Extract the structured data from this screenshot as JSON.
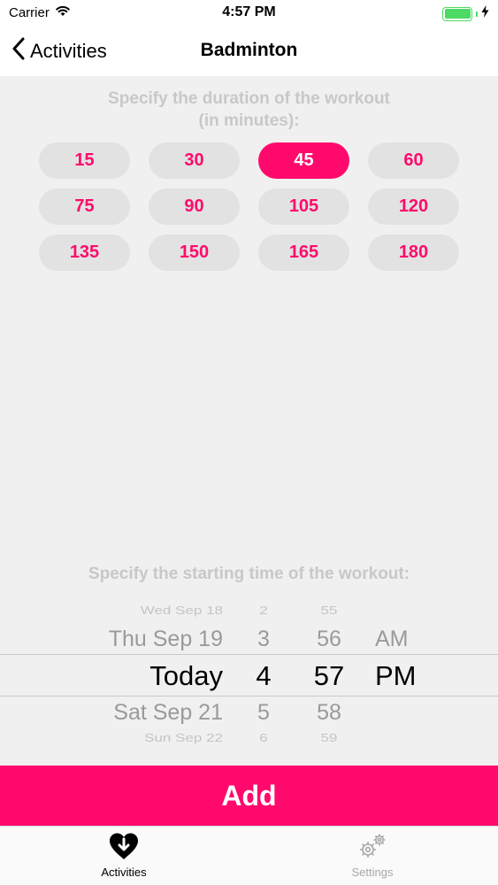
{
  "status_bar": {
    "carrier": "Carrier",
    "time": "4:57 PM",
    "battery_color": "#4cd964",
    "icons": [
      "wifi-icon",
      "battery-icon",
      "charging-bolt-icon"
    ]
  },
  "nav": {
    "back_label": "Activities",
    "title": "Badminton"
  },
  "duration": {
    "title_line1": "Specify the duration of the workout",
    "title_line2": "(in minutes):",
    "options": [
      "15",
      "30",
      "45",
      "60",
      "75",
      "90",
      "105",
      "120",
      "135",
      "150",
      "165",
      "180"
    ],
    "selected": "45"
  },
  "start_time": {
    "title": "Specify the starting time of the workout:",
    "date_column": [
      "Wed Sep 18",
      "Thu Sep 19",
      "Today",
      "Sat Sep 21",
      "Sun Sep 22"
    ],
    "hour_column": [
      "2",
      "3",
      "4",
      "5",
      "6"
    ],
    "minute_column": [
      "55",
      "56",
      "57",
      "58",
      "59"
    ],
    "ampm_column": [
      "",
      "AM",
      "PM",
      "",
      ""
    ]
  },
  "add_button": {
    "label": "Add"
  },
  "tabs": {
    "activities": {
      "label": "Activities",
      "icon": "heart-download-icon"
    },
    "settings": {
      "label": "Settings",
      "icon": "gears-icon"
    }
  },
  "colors": {
    "accent": "#ff0a6c",
    "pill_background": "#e2e2e2",
    "content_background": "#f0f0f0"
  }
}
